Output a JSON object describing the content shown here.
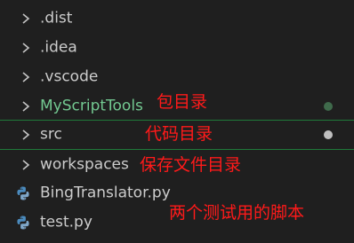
{
  "explorer": {
    "items": [
      {
        "label": ".dist",
        "kind": "folder",
        "icon": "chevron-right-icon"
      },
      {
        "label": ".idea",
        "kind": "folder",
        "icon": "chevron-right-icon"
      },
      {
        "label": ".vscode",
        "kind": "folder",
        "icon": "chevron-right-icon"
      },
      {
        "label": "MyScriptTools",
        "kind": "folder",
        "icon": "chevron-right-icon",
        "status_dot_color": "#3f6a4b",
        "label_color": "#73c991"
      },
      {
        "label": "src",
        "kind": "folder",
        "icon": "chevron-right-icon",
        "status_dot_color": "#bfbfbf"
      },
      {
        "label": "workspaces",
        "kind": "folder",
        "icon": "chevron-right-icon"
      },
      {
        "label": "BingTranslator.py",
        "kind": "file",
        "icon": "python-icon"
      },
      {
        "label": "test.py",
        "kind": "file",
        "icon": "python-icon"
      }
    ]
  },
  "annotations": {
    "package_dir": "包目录",
    "code_dir": "代码目录",
    "workspace_dir": "保存文件目录",
    "test_scripts": "两个测试用的脚本"
  },
  "colors": {
    "background": "#1f1f1f",
    "text": "#cccccc",
    "annotation": "#ff1a1a",
    "highlight_border": "#1f7a3a"
  }
}
